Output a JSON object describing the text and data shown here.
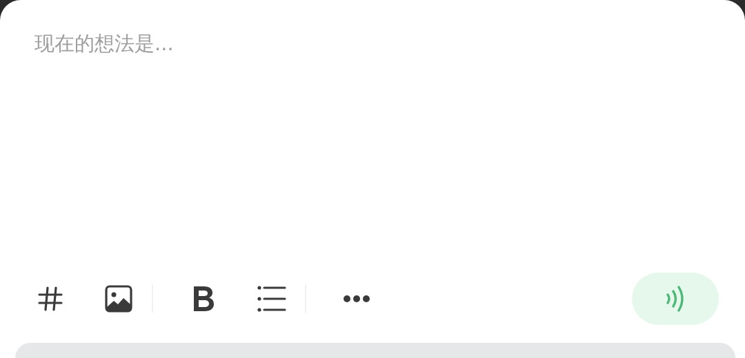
{
  "editor": {
    "placeholder": "现在的想法是..."
  },
  "toolbar": [
    {
      "kind": "tag"
    },
    {
      "kind": "image"
    },
    {
      "kind": "divider"
    },
    {
      "kind": "bold"
    },
    {
      "kind": "list"
    },
    {
      "kind": "divider"
    },
    {
      "kind": "more"
    }
  ]
}
